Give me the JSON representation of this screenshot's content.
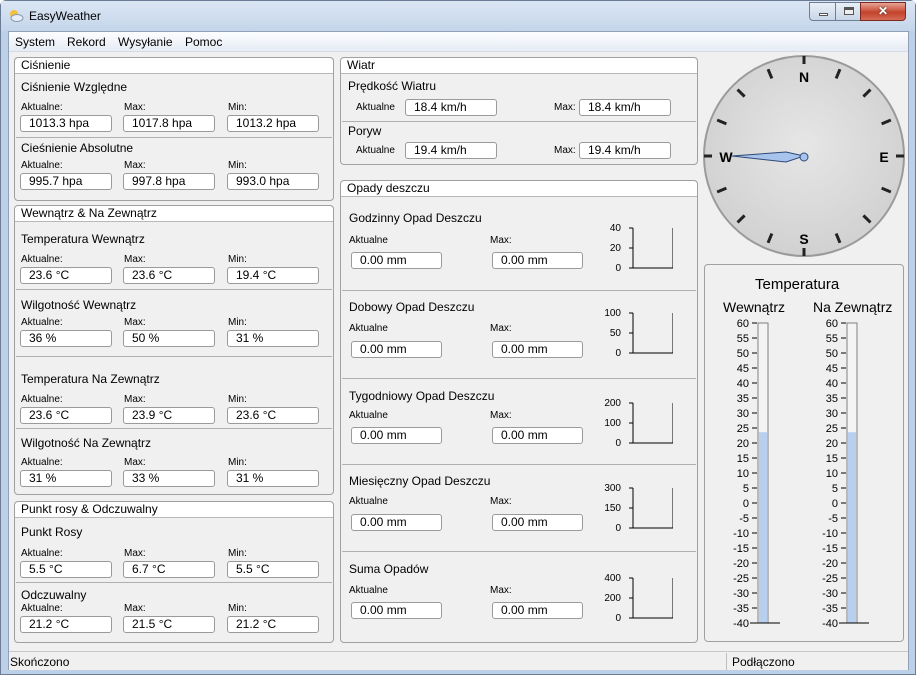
{
  "window": {
    "title": "EasyWeather"
  },
  "menu": [
    "System",
    "Rekord",
    "Wysyłanie",
    "Pomoc"
  ],
  "common": {
    "current": "Aktualne:",
    "max": "Max:",
    "min": "Min:",
    "current_short": "Aktualne",
    "max_short": "Max:"
  },
  "pressure": {
    "title": "Ciśnienie",
    "relative": {
      "title": "Ciśnienie Względne",
      "current": "1013.3 hpa",
      "max": "1017.8 hpa",
      "min": "1013.2 hpa"
    },
    "absolute": {
      "title": "Cieśnienie Absolutne",
      "current": "995.7 hpa",
      "max": "997.8 hpa",
      "min": "993.0 hpa"
    }
  },
  "indoor_outdoor": {
    "title": "Wewnątrz & Na Zewnątrz",
    "rows": [
      {
        "title": "Temperatura Wewnątrz",
        "current": "23.6 °C",
        "max": "23.6 °C",
        "min": "19.4 °C"
      },
      {
        "title": "Wilgotność Wewnątrz",
        "current": "36 %",
        "max": "50 %",
        "min": "31 %"
      },
      {
        "title": "Temperatura Na Zewnątrz",
        "current": "23.6 °C",
        "max": "23.9 °C",
        "min": "23.6 °C"
      },
      {
        "title": "Wilgotność Na Zewnątrz",
        "current": "31 %",
        "max": "33 %",
        "min": "31 %"
      }
    ]
  },
  "dew": {
    "title": "Punkt rosy & Odczuwalny",
    "dew_point": {
      "title": "Punkt Rosy",
      "current": "5.5 °C",
      "max": "6.7 °C",
      "min": "5.5 °C"
    },
    "feels_like": {
      "title": "Odczuwalny",
      "current": "21.2 °C",
      "max": "21.5 °C",
      "min": "21.2 °C"
    }
  },
  "wind": {
    "title": "Wiatr",
    "speed": {
      "title": "Prędkość Wiatru",
      "current": "18.4 km/h",
      "max": "18.4 km/h"
    },
    "gust": {
      "title": "Poryw",
      "current": "19.4 km/h",
      "max": "19.4 km/h"
    }
  },
  "rain": {
    "title": "Opady deszczu",
    "rows": [
      {
        "title": "Godzinny Opad Deszczu",
        "current": "0.00 mm",
        "max": "0.00 mm",
        "scale": [
          "40",
          "20",
          "0"
        ],
        "level": 0
      },
      {
        "title": "Dobowy Opad Deszczu",
        "current": "0.00 mm",
        "max": "0.00 mm",
        "scale": [
          "100",
          "50",
          "0"
        ],
        "level": 0
      },
      {
        "title": "Tygodniowy Opad Deszczu",
        "current": "0.00 mm",
        "max": "0.00 mm",
        "scale": [
          "200",
          "100",
          "0"
        ],
        "level": 0
      },
      {
        "title": "Miesięczny Opad Deszczu",
        "current": "0.00 mm",
        "max": "0.00 mm",
        "scale": [
          "300",
          "150",
          "0"
        ],
        "level": 0
      },
      {
        "title": "Suma Opadów",
        "current": "0.00 mm",
        "max": "0.00 mm",
        "scale": [
          "400",
          "200",
          "0"
        ],
        "level": 0
      }
    ]
  },
  "compass": {
    "n": "N",
    "e": "E",
    "s": "S",
    "w": "W",
    "direction_deg": 270,
    "arrow_color": "#a8c4ec"
  },
  "thermometer": {
    "title": "Temperatura",
    "indoor_label": "Wewnątrz",
    "outdoor_label": "Na Zewnątrz",
    "scale": [
      "60",
      "55",
      "50",
      "45",
      "40",
      "35",
      "30",
      "25",
      "20",
      "15",
      "10",
      "5",
      "0",
      "-5",
      "-10",
      "-15",
      "-20",
      "-25",
      "-30",
      "-35",
      "-40"
    ],
    "scale_min": -40,
    "scale_max": 60,
    "indoor_value": 23.6,
    "outdoor_value": 23.6,
    "fill_color": "#b8cff0"
  },
  "status": {
    "left": "Skończono",
    "right": "Podłączono"
  }
}
